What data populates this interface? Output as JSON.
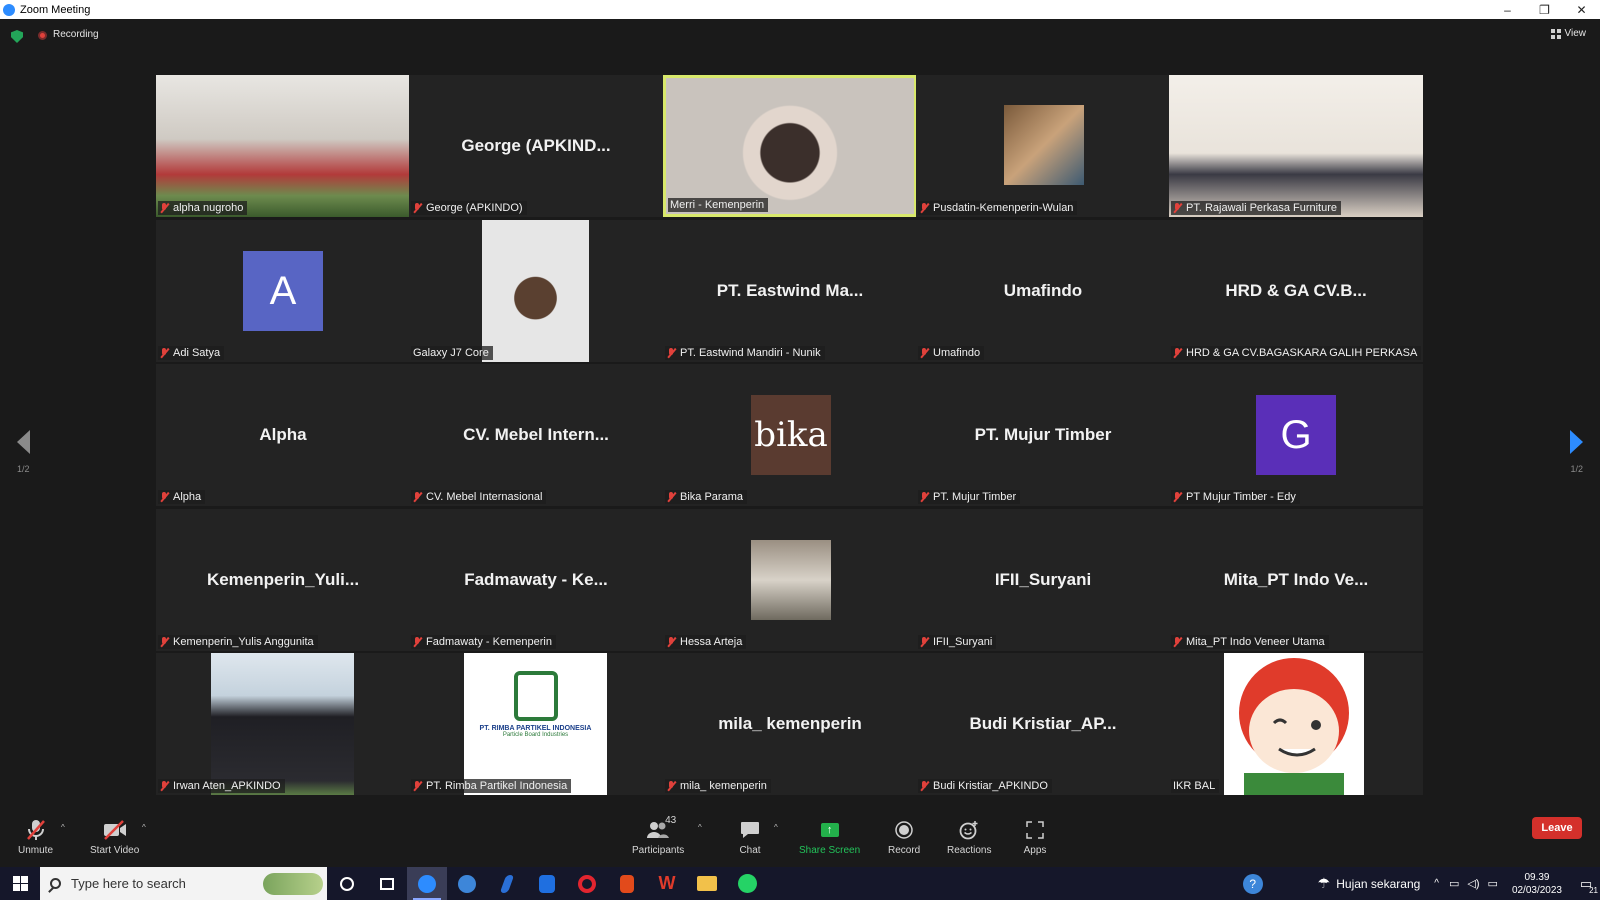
{
  "window": {
    "title": "Zoom Meeting",
    "minimize": "–",
    "restore": "❐",
    "close": "✕"
  },
  "topbar": {
    "recording_label": "Recording",
    "view_label": "View"
  },
  "pagination": {
    "left": "1/2",
    "right": "1/2"
  },
  "tiles": [
    {
      "name": "alpha nugroho",
      "type": "video",
      "muted": true
    },
    {
      "name": "George (APKINDO)",
      "display": "George  (APKIND...",
      "type": "name",
      "muted": true
    },
    {
      "name": "Merri - Kemenperin",
      "type": "video",
      "muted": false,
      "active": true
    },
    {
      "name": "Pusdatin-Kemenperin-Wulan",
      "type": "photo",
      "muted": true
    },
    {
      "name": "PT. Rajawali Perkasa Furniture",
      "type": "video",
      "muted": true
    },
    {
      "name": "Adi Satya",
      "type": "letter",
      "letter": "A",
      "color": "#5865c4",
      "muted": true
    },
    {
      "name": "Galaxy J7 Core",
      "type": "photo",
      "muted": false
    },
    {
      "name": "PT. Eastwind Mandiri - Nunik",
      "display": "PT. Eastwind Ma...",
      "type": "name",
      "muted": true
    },
    {
      "name": "Umafindo",
      "display": "Umafindo",
      "type": "name",
      "muted": true
    },
    {
      "name": "HRD & GA CV.BAGASKARA GALIH PERKASA",
      "display": "HRD & GA CV.B...",
      "type": "name",
      "muted": true
    },
    {
      "name": "Alpha",
      "display": "Alpha",
      "type": "name",
      "muted": true
    },
    {
      "name": "CV. Mebel Internasional",
      "display": "CV. Mebel Intern...",
      "type": "name",
      "muted": true
    },
    {
      "name": "Bika Parama",
      "type": "logo",
      "logo_text": "bika",
      "muted": true
    },
    {
      "name": "PT. Mujur Timber",
      "display": "PT. Mujur Timber",
      "type": "name",
      "muted": true
    },
    {
      "name": "PT Mujur Timber - Edy",
      "type": "letter",
      "letter": "G",
      "color": "#5a2fb8",
      "muted": true
    },
    {
      "name": "Kemenperin_Yulis Anggunita",
      "display": "Kemenperin_Yuli...",
      "type": "name",
      "muted": true
    },
    {
      "name": "Fadmawaty - Kemenperin",
      "display": "Fadmawaty - Ke...",
      "type": "name",
      "muted": true
    },
    {
      "name": "Hessa Arteja",
      "type": "photo",
      "muted": true
    },
    {
      "name": "IFII_Suryani",
      "display": "IFII_Suryani",
      "type": "name",
      "muted": true
    },
    {
      "name": "Mita_PT Indo Veneer Utama",
      "display": "Mita_PT Indo Ve...",
      "type": "name",
      "muted": true
    },
    {
      "name": "Irwan Aten_APKINDO",
      "type": "photo",
      "muted": true
    },
    {
      "name": "PT. Rimba Partikel Indonesia",
      "type": "logo",
      "logo_text": "PT. RIMBA PARTIKEL INDONESIA",
      "logo_sub": "Particle Board Industries",
      "muted": true
    },
    {
      "name": "mila_ kemenperin",
      "display": "mila_ kemenperin",
      "type": "name",
      "muted": true
    },
    {
      "name": "Budi Kristiar_APKINDO",
      "display": "Budi  Kristiar_AP...",
      "type": "name",
      "muted": true
    },
    {
      "name": "IKR BAL",
      "type": "cartoon",
      "muted": false
    }
  ],
  "toolbar": {
    "unmute": "Unmute",
    "start_video": "Start Video",
    "participants": "Participants",
    "participants_count": "43",
    "chat": "Chat",
    "share_screen": "Share Screen",
    "record": "Record",
    "reactions": "Reactions",
    "apps": "Apps",
    "leave": "Leave"
  },
  "taskbar": {
    "search_placeholder": "Type here to search",
    "weather": "Hujan sekarang",
    "time": "09.39",
    "date": "02/03/2023",
    "notification_count": "21"
  },
  "colors": {
    "accent": "#2d8cff",
    "active_border": "#d8e86b",
    "leave": "#d4302b",
    "share": "#23b04b",
    "muted": "#e0413b"
  }
}
